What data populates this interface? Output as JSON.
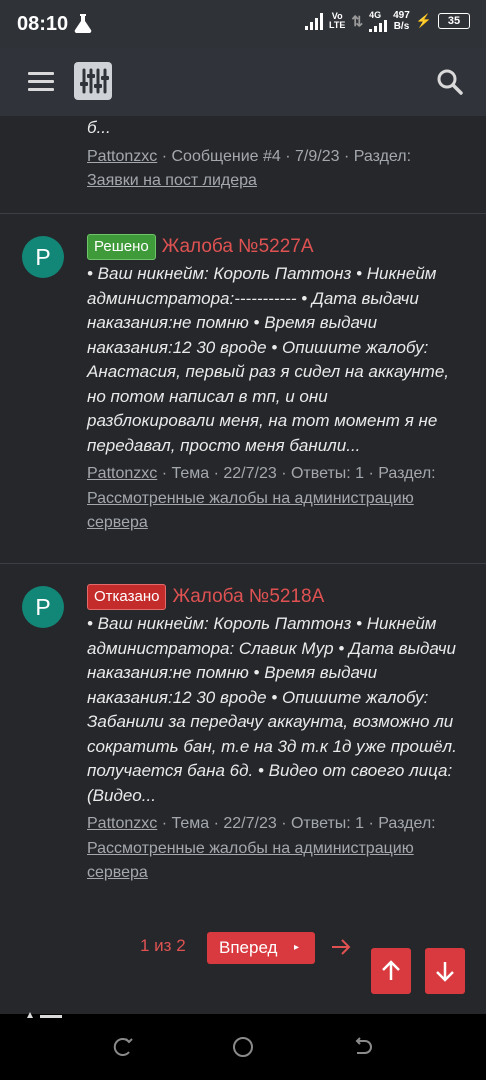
{
  "status_bar": {
    "time": "08:10",
    "network_vo": "Vo",
    "network_lte": "LTE",
    "network_4g": "4G",
    "speed_value": "497",
    "speed_unit": "B/s",
    "battery": "35"
  },
  "app_bar": {
    "menu_icon": "hamburger-icon",
    "logo_icon": "sliders-icon",
    "search_icon": "search-icon"
  },
  "posts": [
    {
      "snippet": "б...",
      "author": "Pattonzxc",
      "meta_mid": " · Сообщение #4 · 7/9/23 · Раздел: ",
      "section_link": "Заявки на пост лидера"
    },
    {
      "avatar_letter": "P",
      "status_badge": "Решено",
      "title": "Жалоба №5227А",
      "snippet": "• Ваш никнейм: Король Паттонз • Никнейм администратора:----------- • Дата выдачи наказания:не помню • Время выдачи наказания:12 30 вроде • Опишите жалобу: Анастасия, первый раз я сидел на аккаунте, но потом написал в тп, и они разблокировали меня, на тот момент я не передавал, просто меня банили...",
      "author": "Pattonzxc",
      "meta_mid": " · Тема · 22/7/23 · Ответы: 1 · Раздел: ",
      "section_link": "Рассмотренные жалобы на администрацию сервера"
    },
    {
      "avatar_letter": "P",
      "status_badge": "Отказано",
      "title": "Жалоба №5218А",
      "snippet": "• Ваш никнейм: Король Паттонз • Никнейм администратора: Славик Мур • Дата выдачи наказания:не помню • Время выдачи наказания:12 30 вроде • Опишите жалобу: Забанили за передачу аккаунта, возможно ли сократить бан, т.е на 3д т.к 1д уже прошёл. получается бана 6д. • Видео от своего лица: (Видео...",
      "author": "Pattonzxc",
      "meta_mid": " · Тема · 22/7/23 · Ответы: 1 · Раздел: ",
      "section_link": "Рассмотренные жалобы на администрацию сервера"
    }
  ],
  "pager": {
    "page_count": "1 из 2",
    "next_label": "Вперед",
    "next_caret": "▸"
  },
  "colors": {
    "accent": "#d93a3f",
    "resolved": "#3f9a3a",
    "rejected": "#c42c2c",
    "avatar": "#128677"
  }
}
